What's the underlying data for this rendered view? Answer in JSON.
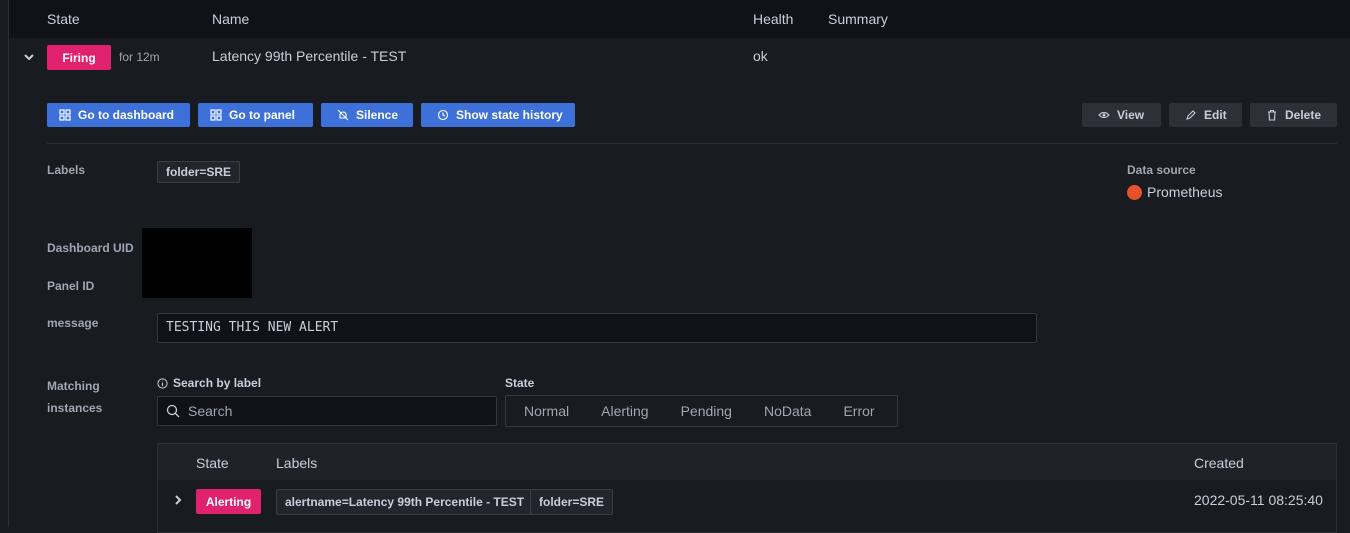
{
  "table_header": {
    "state": "State",
    "name": "Name",
    "health": "Health",
    "summary": "Summary"
  },
  "rule": {
    "state_badge": "Firing",
    "duration": "for 12m",
    "name": "Latency 99th Percentile - TEST",
    "health": "ok",
    "badge_color": "#e0226e"
  },
  "actions": {
    "go_to_dashboard": "Go to dashboard",
    "go_to_panel": "Go to panel",
    "silence": "Silence",
    "show_state_history": "Show state history",
    "view": "View",
    "edit": "Edit",
    "delete": "Delete"
  },
  "details": {
    "labels_label": "Labels",
    "labels": [
      "folder=SRE"
    ],
    "data_source_label": "Data source",
    "data_source": "Prometheus",
    "dashboard_uid_label": "Dashboard UID",
    "panel_id_label": "Panel ID",
    "message_label": "message",
    "message_value": "TESTING THIS NEW ALERT"
  },
  "instances": {
    "section_label_line1": "Matching",
    "section_label_line2": "instances",
    "search_by_label": "Search by label",
    "search_placeholder": "Search",
    "state_label": "State",
    "state_options": [
      "Normal",
      "Alerting",
      "Pending",
      "NoData",
      "Error"
    ],
    "columns": {
      "state": "State",
      "labels": "Labels",
      "created": "Created"
    },
    "rows": [
      {
        "state": "Alerting",
        "labels": [
          "alertname=Latency 99th Percentile - TEST",
          "folder=SRE"
        ],
        "created": "2022-05-11 08:25:40"
      }
    ]
  },
  "colors": {
    "primary_button": "#3d71d9",
    "firing": "#e0226e",
    "background": "#181b1f",
    "prometheus": "#e6522c"
  }
}
